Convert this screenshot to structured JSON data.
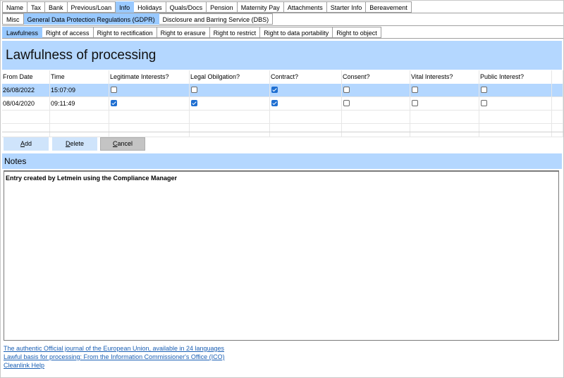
{
  "tabs_row1": [
    {
      "label": "Name",
      "active": false
    },
    {
      "label": "Tax",
      "active": false
    },
    {
      "label": "Bank",
      "active": false
    },
    {
      "label": "Previous/Loan",
      "active": false
    },
    {
      "label": "Info",
      "active": true
    },
    {
      "label": "Holidays",
      "active": false
    },
    {
      "label": "Quals/Docs",
      "active": false
    },
    {
      "label": "Pension",
      "active": false
    },
    {
      "label": "Maternity Pay",
      "active": false
    },
    {
      "label": "Attachments",
      "active": false
    },
    {
      "label": "Starter Info",
      "active": false
    },
    {
      "label": "Bereavement",
      "active": false
    }
  ],
  "tabs_row2": [
    {
      "label": "Misc",
      "active": false
    },
    {
      "label": "General Data Protection Regulations (GDPR)",
      "active": true
    },
    {
      "label": "Disclosure and Barring Service (DBS)",
      "active": false
    }
  ],
  "tabs_row3": [
    {
      "label": "Lawfulness",
      "active": true
    },
    {
      "label": "Right of access",
      "active": false
    },
    {
      "label": "Right to rectification",
      "active": false
    },
    {
      "label": "Right to erasure",
      "active": false
    },
    {
      "label": "Right to restrict",
      "active": false
    },
    {
      "label": "Right to data portability",
      "active": false
    },
    {
      "label": "Right to object",
      "active": false
    }
  ],
  "section_title": "Lawfulness of processing",
  "grid": {
    "columns": [
      "From Date",
      "Time",
      "Legitimate Interests?",
      "Legal Obilgation?",
      "Contract?",
      "Consent?",
      "Vital Interests?",
      "Public Interest?"
    ],
    "rows": [
      {
        "date": "26/08/2022",
        "time": "15:07:09",
        "flags": [
          false,
          false,
          true,
          false,
          false,
          false
        ],
        "selected": true
      },
      {
        "date": "08/04/2020",
        "time": "09:11:49",
        "flags": [
          true,
          true,
          true,
          false,
          false,
          false
        ],
        "selected": false
      }
    ]
  },
  "buttons": {
    "add": {
      "accel": "A",
      "rest": "dd"
    },
    "delete": {
      "accel": "D",
      "rest": "elete"
    },
    "cancel": {
      "accel": "C",
      "rest": "ancel"
    }
  },
  "notes": {
    "label": "Notes",
    "text": "Entry created by Letmein using the Compliance Manager"
  },
  "links": [
    "The authentic Official journal of the European Union, available in 24 languages",
    "Lawful basis for processing: From the Information Commissioner's Office (ICO)",
    "Cleanlink Help"
  ],
  "colors": {
    "accent": "#b4d7ff",
    "active_tab": "#99c9ff",
    "check": "#1f6fd1",
    "link": "#1a5fb4"
  }
}
